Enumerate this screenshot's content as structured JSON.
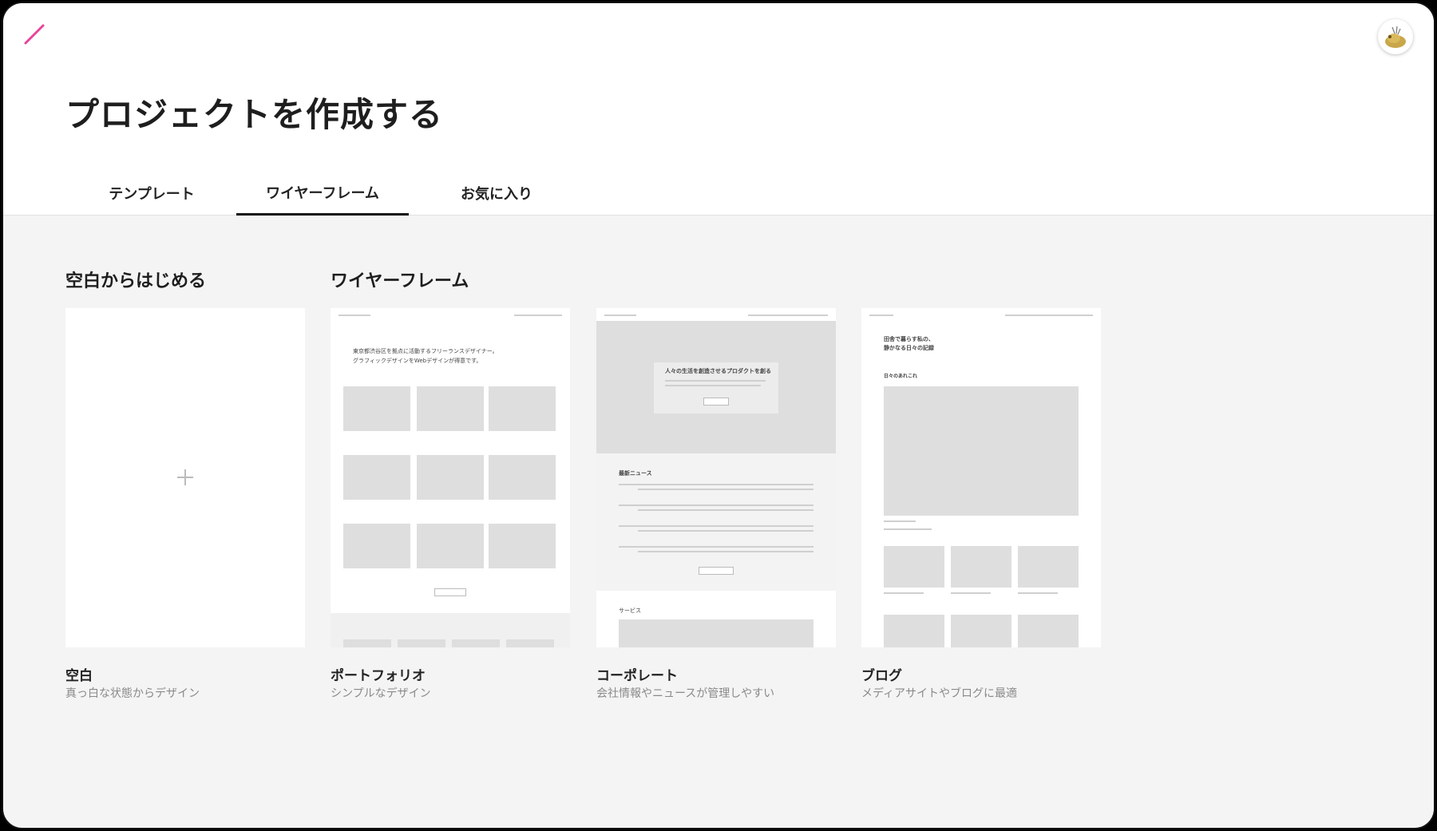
{
  "page": {
    "title": "プロジェクトを作成する"
  },
  "tabs": [
    {
      "label": "テンプレート",
      "active": false
    },
    {
      "label": "ワイヤーフレーム",
      "active": true
    },
    {
      "label": "お気に入り",
      "active": false
    }
  ],
  "sections": {
    "blank": "空白からはじめる",
    "wireframe": "ワイヤーフレーム"
  },
  "cards": [
    {
      "name": "空白",
      "desc": "真っ白な状態からデザイン"
    },
    {
      "name": "ポートフォリオ",
      "desc": "シンプルなデザイン"
    },
    {
      "name": "コーポレート",
      "desc": "会社情報やニュースが管理しやすい"
    },
    {
      "name": "ブログ",
      "desc": "メディアサイトやブログに最適"
    }
  ],
  "previews": {
    "portfolio_heading": "東京都渋谷区を拠点に活動するフリーランスデザイナー。\nグラフィックデザインをWebデザインが得意です。",
    "corporate_hero": "人々の生活を創造させるプロダクトを創る",
    "corporate_news": "最新ニュース",
    "corporate_service": "サービス",
    "blog_heading": "田舎で暮らす私の、\n静かなる日々の記録",
    "blog_section": "日々のあれこれ"
  },
  "colors": {
    "accent": "#e8439a",
    "tab_underline": "#111111",
    "background": "#f4f4f4"
  }
}
